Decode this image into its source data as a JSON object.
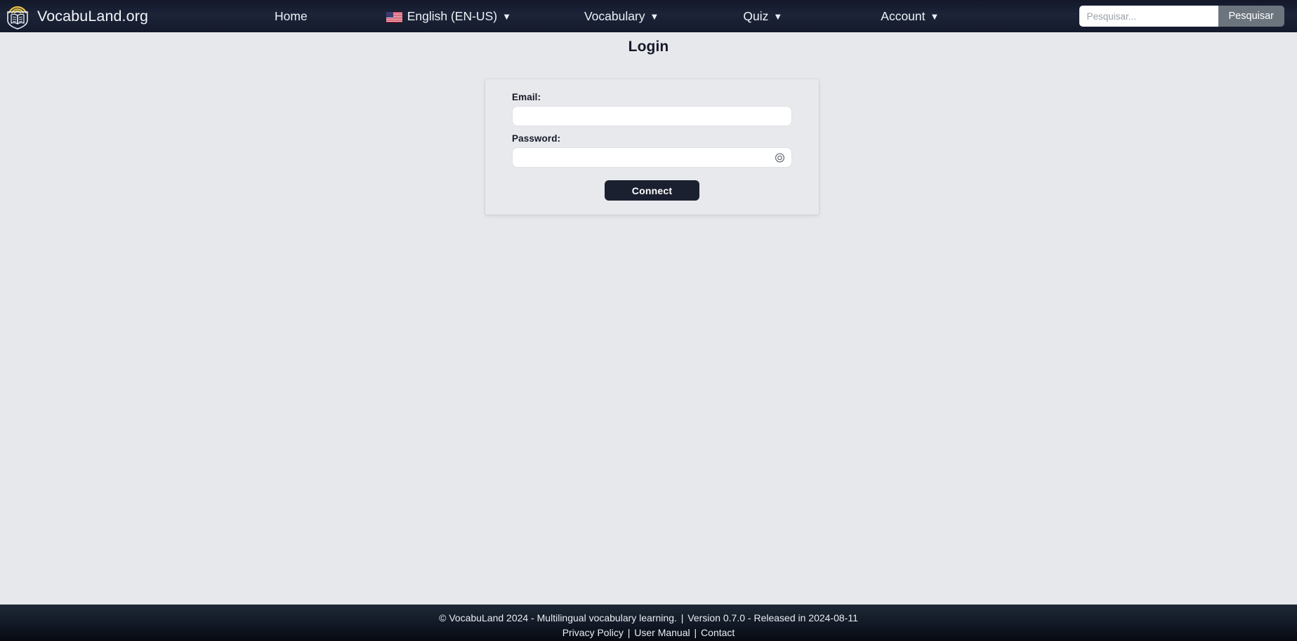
{
  "navbar": {
    "brand": {
      "logo_icon": "audiobook-shield-icon",
      "text": "VocabuLand.org"
    },
    "items": [
      {
        "label": "Home",
        "icon": null,
        "caret": false
      },
      {
        "label": "English (EN-US)",
        "icon": "us-flag-icon",
        "caret": true,
        "caret_glyph": "▼"
      },
      {
        "label": "Vocabulary",
        "icon": null,
        "caret": true,
        "caret_glyph": "▼"
      },
      {
        "label": "Quiz",
        "icon": null,
        "caret": true,
        "caret_glyph": "▼"
      },
      {
        "label": "Account",
        "icon": null,
        "caret": true,
        "caret_glyph": "▼"
      }
    ],
    "search": {
      "placeholder": "Pesquisar...",
      "value": "",
      "button_label": "Pesquisar"
    }
  },
  "main": {
    "title": "Login",
    "form": {
      "email": {
        "label": "Email:",
        "value": "",
        "placeholder": ""
      },
      "password": {
        "label": "Password:",
        "value": "",
        "placeholder": "",
        "toggle_icon": "eye-reveal-icon"
      },
      "submit_label": "Connect"
    }
  },
  "footer": {
    "copyright": "© VocabuLand 2024 - Multilingual vocabulary learning.",
    "separator": "|",
    "version": "Version 0.7.0 - Released in 2024-08-11",
    "links": [
      {
        "label": "Privacy Policy"
      },
      {
        "label": "User Manual"
      },
      {
        "label": "Contact"
      }
    ]
  },
  "colors": {
    "navbar_dark": "#1c2438",
    "page_background": "#e7e8eb",
    "card_background": "#e8e9ec",
    "button_primary": "#1a2030",
    "search_button": "#6c757d",
    "footer_top": "#1e2836",
    "logo_accent": "#e8c547"
  }
}
